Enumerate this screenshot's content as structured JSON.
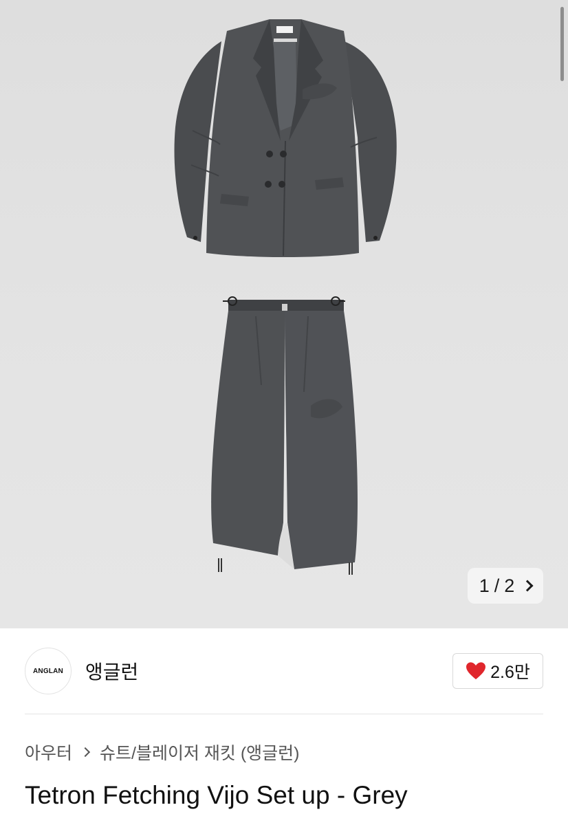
{
  "gallery": {
    "current": "1",
    "separator": "/",
    "total": "2"
  },
  "brand": {
    "logo_text": "ANGLAN",
    "name": "앵글런"
  },
  "like": {
    "count": "2.6만",
    "color": "#e0262c"
  },
  "breadcrumb": {
    "category": "아우터",
    "subcategory": "슈트/블레이저 재킷 (앵글런)"
  },
  "product": {
    "title": "Tetron Fetching Vijo Set up - Grey"
  }
}
